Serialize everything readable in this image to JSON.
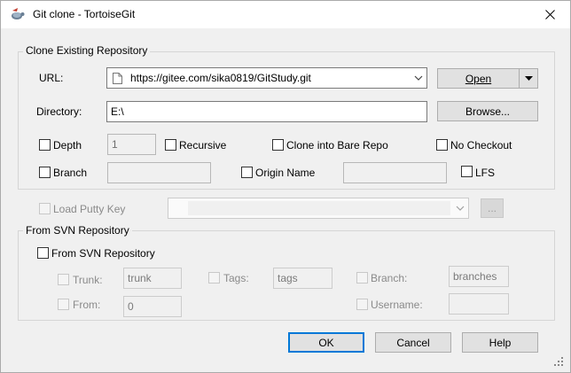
{
  "window": {
    "title": "Git clone - TortoiseGit"
  },
  "clone_group": {
    "legend": "Clone Existing Repository",
    "url_label": "URL:",
    "url_value": "https://gitee.com/sika0819/GitStudy.git",
    "open_label": "Open",
    "directory_label": "Directory:",
    "directory_value": "E:\\",
    "browse_label": "Browse...",
    "depth_label": "Depth",
    "depth_value": "1",
    "recursive_label": "Recursive",
    "bare_label": "Clone into Bare Repo",
    "no_checkout_label": "No Checkout",
    "branch_label": "Branch",
    "branch_value": "",
    "origin_label": "Origin Name",
    "origin_value": "",
    "lfs_label": "LFS"
  },
  "putty": {
    "label": "Load Putty Key",
    "value": "",
    "browse_label": "..."
  },
  "svn_group": {
    "legend": "From SVN Repository",
    "from_svn_label": "From SVN Repository",
    "trunk_label": "Trunk:",
    "trunk_value": "trunk",
    "tags_label": "Tags:",
    "tags_value": "tags",
    "branch_label": "Branch:",
    "branch_value": "branches",
    "from_label": "From:",
    "from_value": "0",
    "username_label": "Username:",
    "username_value": ""
  },
  "buttons": {
    "ok": "OK",
    "cancel": "Cancel",
    "help": "Help"
  },
  "colors": {
    "accent": "#0078d7",
    "disabled_text": "#8a8a8a",
    "dialog_bg": "#f0f0f0"
  }
}
